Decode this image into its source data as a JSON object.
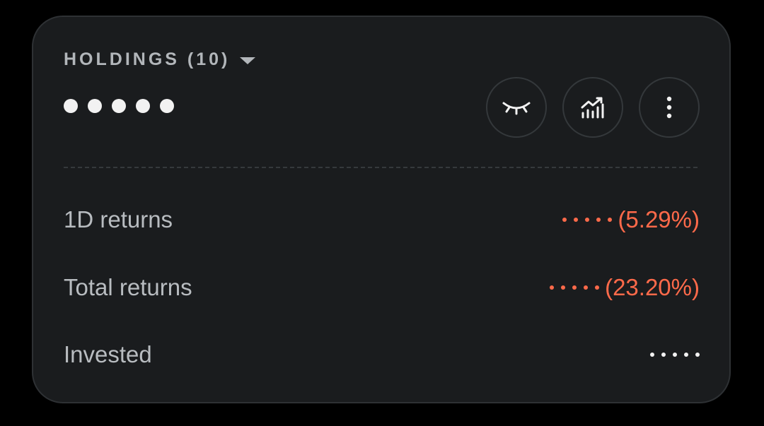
{
  "holdings": {
    "title": "HOLDINGS (10)",
    "masked_value": "•••••"
  },
  "actions": {
    "hide_values": "eye-closed-icon",
    "analytics": "chart-icon",
    "more": "more-vertical-icon"
  },
  "rows": [
    {
      "label": "1D returns",
      "value": "(5.29%)",
      "color": "#ff6a4a"
    },
    {
      "label": "Total returns",
      "value": "(23.20%)",
      "color": "#ff6a4a"
    },
    {
      "label": "Invested",
      "value": ""
    }
  ],
  "colors": {
    "card_background": "#1a1c1e",
    "negative": "#ff6a4a",
    "text_secondary": "#b8bcc0"
  }
}
